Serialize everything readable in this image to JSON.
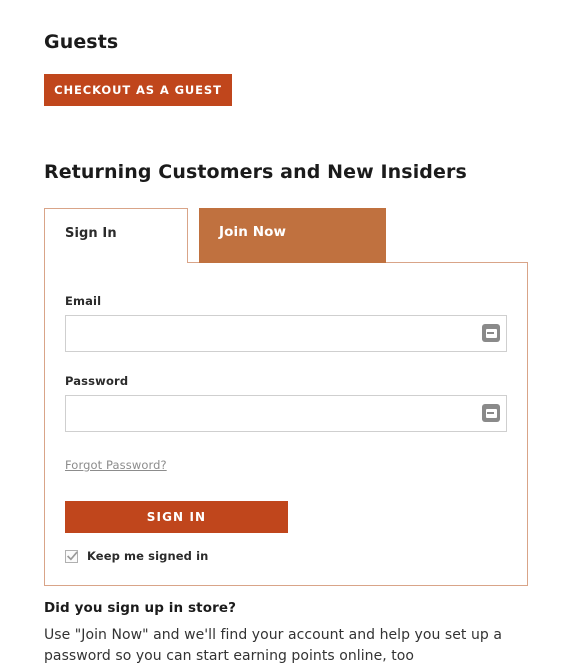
{
  "guests": {
    "heading": "Guests",
    "checkout_button": "CHECKOUT AS A GUEST"
  },
  "returning": {
    "heading": "Returning Customers and New Insiders",
    "tabs": [
      {
        "label": "Sign In",
        "active": true
      },
      {
        "label": "Join Now",
        "active": false
      }
    ]
  },
  "form": {
    "email": {
      "label": "Email",
      "value": "",
      "placeholder": "",
      "autofill_icon": "autofill-dots-icon"
    },
    "password": {
      "label": "Password",
      "value": "",
      "placeholder": "",
      "autofill_icon": "autofill-dots-icon"
    },
    "forgot_password": "Forgot Password?",
    "submit_button": "SIGN IN",
    "keep_signed_in": {
      "label": "Keep me signed in",
      "checked": true
    }
  },
  "note": {
    "heading": "Did you sign up in store?",
    "body": "Use \"Join Now\" and we'll find your account and help you set up a password so you can start earning points online, too"
  },
  "colors": {
    "primary_button": "#c0461c",
    "tab_inactive": "#c0713f",
    "panel_border": "#d9a488",
    "input_border": "#cfcfcf",
    "link_gray": "#8c8c8c"
  }
}
